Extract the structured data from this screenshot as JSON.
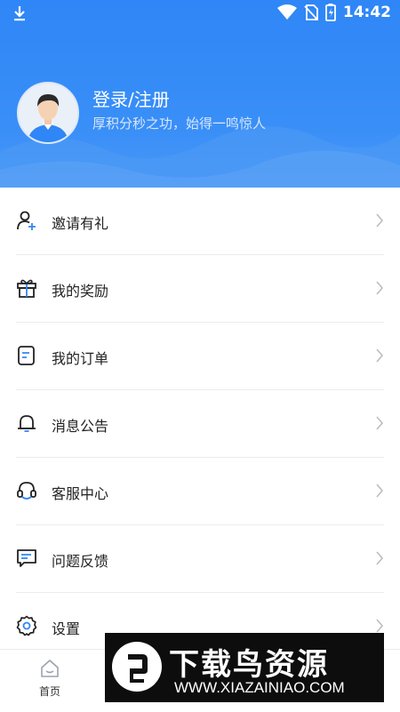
{
  "status_bar": {
    "time": "14:42",
    "icons": [
      "download-icon",
      "wifi-icon",
      "no-sim-icon",
      "battery-icon"
    ]
  },
  "profile": {
    "login_label": "登录/注册",
    "subtitle": "厚积分秒之功，始得一鸣惊人"
  },
  "menu": [
    {
      "label": "邀请有礼",
      "icon": "add-user-icon"
    },
    {
      "label": "我的奖励",
      "icon": "gift-icon"
    },
    {
      "label": "我的订单",
      "icon": "order-icon"
    },
    {
      "label": "消息公告",
      "icon": "bell-icon"
    },
    {
      "label": "客服中心",
      "icon": "headset-icon"
    },
    {
      "label": "问题反馈",
      "icon": "feedback-icon"
    },
    {
      "label": "设置",
      "icon": "settings-icon"
    }
  ],
  "bottom_nav": {
    "home_label": "首页"
  },
  "watermark": {
    "title": "下载鸟资源",
    "url": "WWW.XIAZAINIAO.COM"
  },
  "colors": {
    "header_blue": "#2f86f6",
    "icon_accent": "#2f86f6"
  }
}
